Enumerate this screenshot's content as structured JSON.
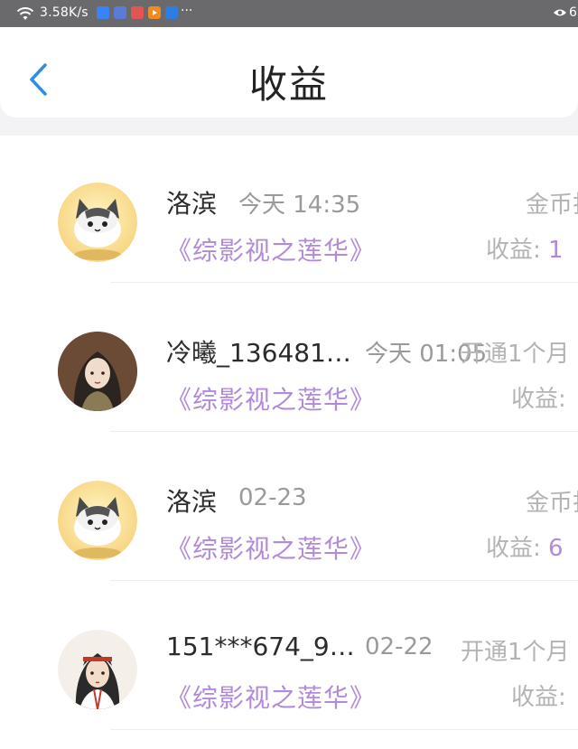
{
  "status_bar": {
    "speed": "3.58K/s",
    "more": "···",
    "right_text": "6"
  },
  "header": {
    "title": "收益"
  },
  "records": [
    {
      "name": "洛滨",
      "time": "今天 14:35",
      "book": "《综影视之莲华》",
      "type": "金币打",
      "income_label": "收益:",
      "income_value": "1"
    },
    {
      "name": "冷曦_136481…",
      "time": "今天 01:05",
      "book": "《综影视之莲华》",
      "type": "开通1个月",
      "income_label": "收益:",
      "income_value": ""
    },
    {
      "name": "洛滨",
      "time": "02-23",
      "book": "《综影视之莲华》",
      "type": "金币打",
      "income_label": "收益:",
      "income_value": "6"
    },
    {
      "name": "151***674_9…",
      "time": "02-22",
      "book": "《综影视之莲华》",
      "type": "开通1个月",
      "income_label": "收益:",
      "income_value": ""
    }
  ],
  "colors": {
    "accent": "#b18ad9",
    "back_icon": "#2f8de4",
    "status_bar": "#6a6a6d"
  },
  "icons": {
    "back": "chevron-left-icon",
    "wifi": "wifi-icon",
    "eye": "eye-icon"
  }
}
